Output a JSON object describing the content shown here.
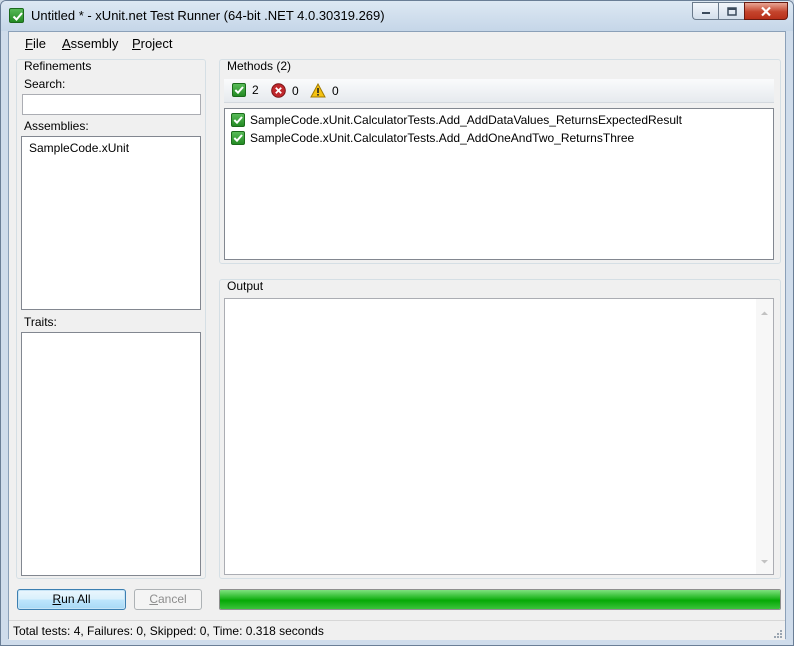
{
  "window": {
    "title": "Untitled * - xUnit.net Test Runner (64-bit .NET 4.0.30319.269)",
    "accent": "#2a9a2a"
  },
  "menu": {
    "file": "File",
    "assembly": "Assembly",
    "project": "Project"
  },
  "refinements": {
    "title": "Refinements",
    "search_label": "Search:",
    "search_value": "",
    "assemblies_label": "Assemblies:",
    "assemblies": [
      "SampleCode.xUnit"
    ],
    "traits_label": "Traits:"
  },
  "methods": {
    "title": "Methods (2)",
    "passed_count": "2",
    "failed_count": "0",
    "skipped_count": "0",
    "items": [
      {
        "name": "SampleCode.xUnit.CalculatorTests.Add_AddDataValues_ReturnsExpectedResult",
        "status": "passed"
      },
      {
        "name": "SampleCode.xUnit.CalculatorTests.Add_AddOneAndTwo_ReturnsThree",
        "status": "passed"
      }
    ]
  },
  "output": {
    "title": "Output",
    "text": ""
  },
  "buttons": {
    "run_all": "Run All",
    "cancel": "Cancel"
  },
  "progress": {
    "fraction": 1.0,
    "color": "#1fb51f"
  },
  "status": {
    "text": "Total tests: 4, Failures: 0, Skipped: 0, Time: 0.318 seconds"
  },
  "icons": {
    "app": "green-check-icon",
    "passed": "green-check-icon",
    "failed": "red-x-icon",
    "skipped": "warning-triangle-icon"
  }
}
